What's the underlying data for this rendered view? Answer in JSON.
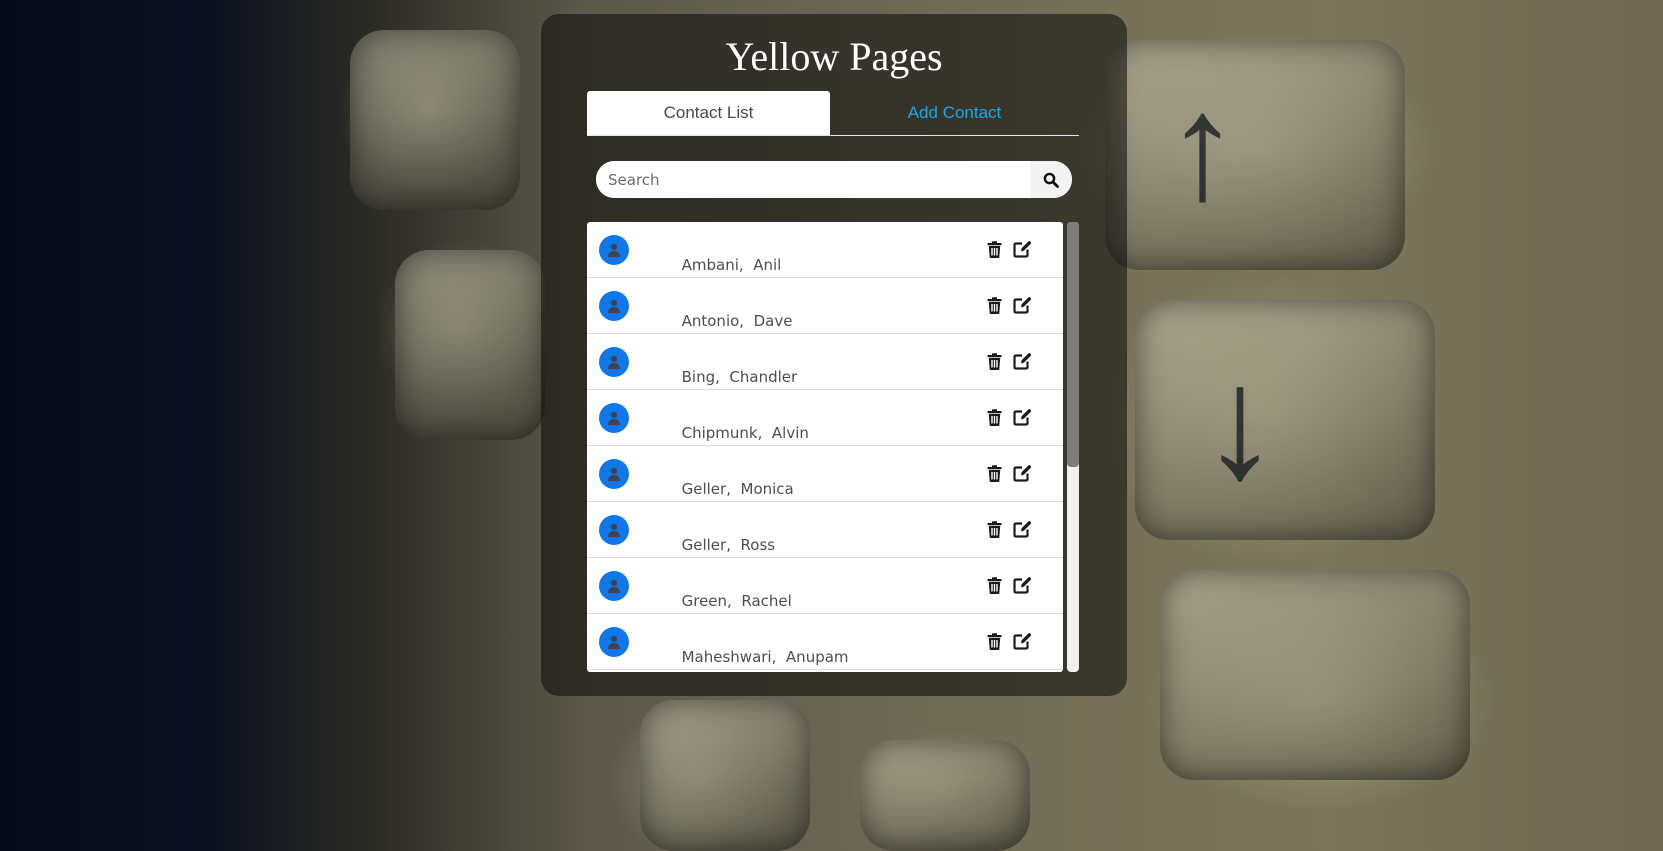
{
  "app": {
    "title": "Yellow Pages"
  },
  "tabs": [
    {
      "label": "Contact List",
      "active": true
    },
    {
      "label": "Add Contact",
      "active": false
    }
  ],
  "search": {
    "placeholder": "Search",
    "value": "",
    "icon": "search-icon"
  },
  "contacts": [
    {
      "last": "Ambani",
      "first": "Anil"
    },
    {
      "last": "Antonio",
      "first": "Dave"
    },
    {
      "last": "Bing",
      "first": "Chandler"
    },
    {
      "last": "Chipmunk",
      "first": "Alvin"
    },
    {
      "last": "Geller",
      "first": "Monica"
    },
    {
      "last": "Geller",
      "first": "Ross"
    },
    {
      "last": "Green",
      "first": "Rachel"
    },
    {
      "last": "Maheshwari",
      "first": "Anupam"
    }
  ],
  "row_icons": {
    "avatar": "user-icon",
    "delete": "trash-icon",
    "edit": "edit-icon"
  },
  "colors": {
    "accent": "#1ea7e4",
    "avatar": "#1177e8"
  }
}
